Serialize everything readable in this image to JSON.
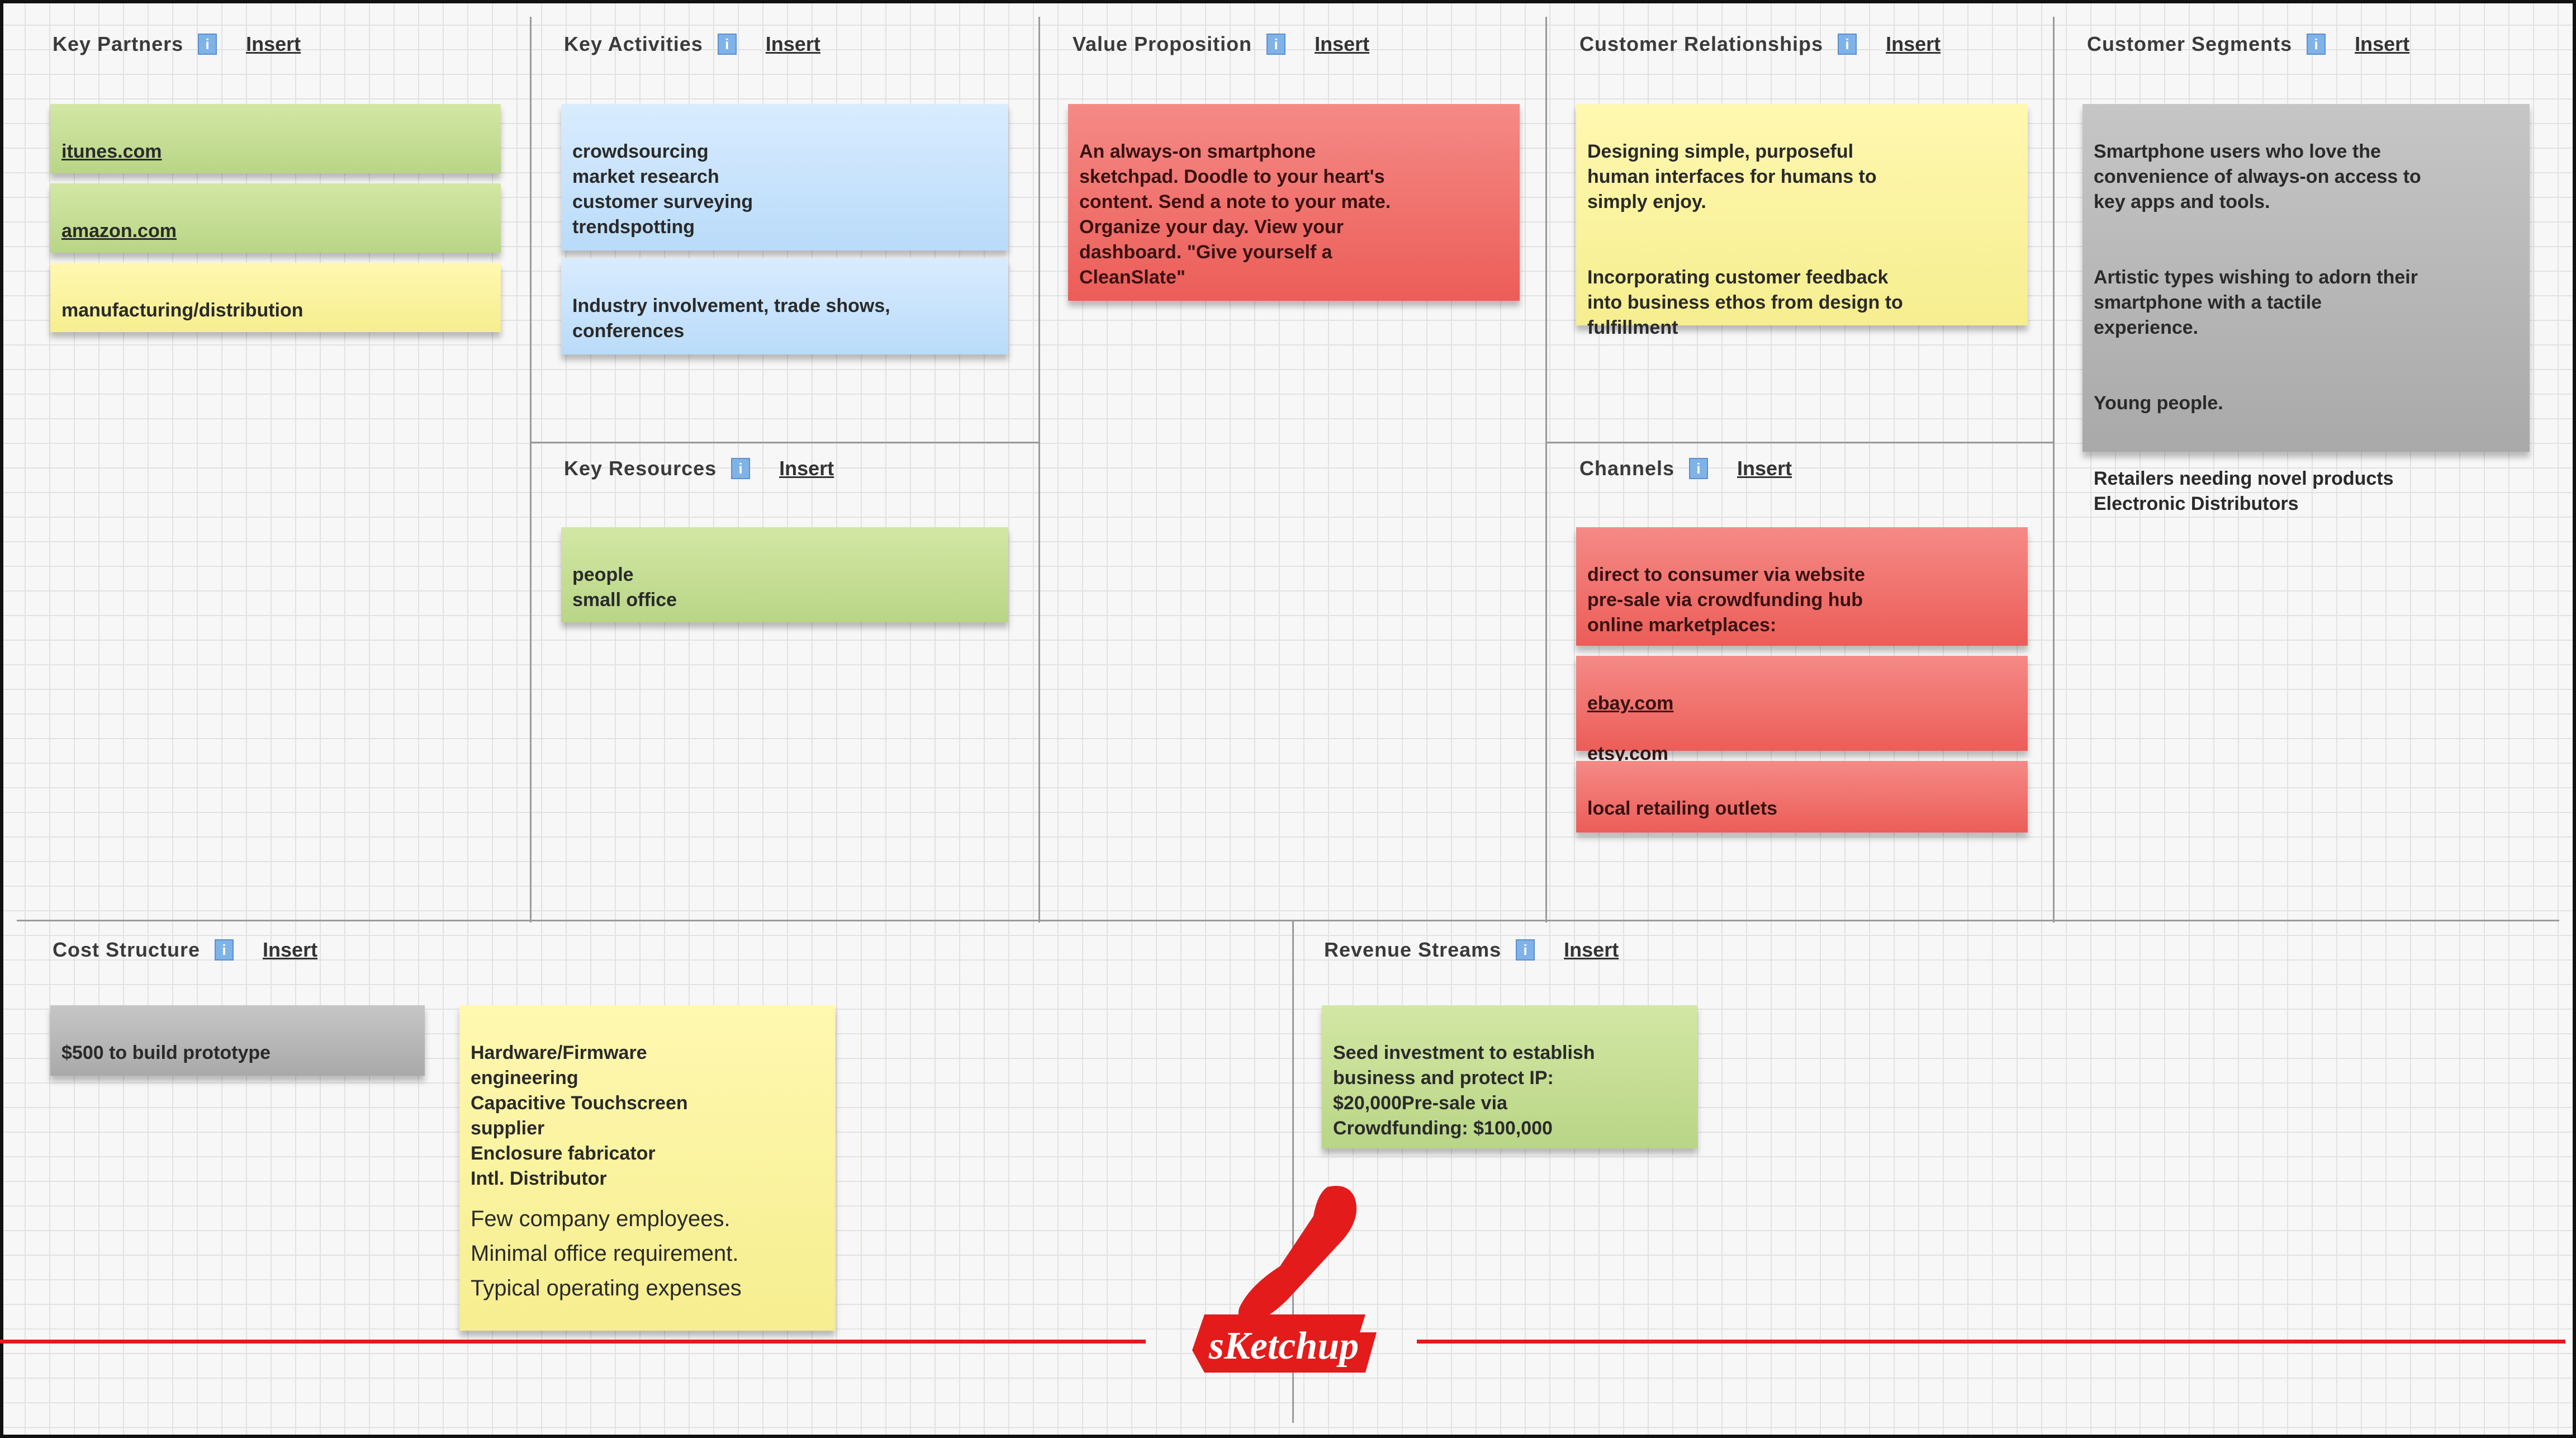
{
  "blocks": {
    "key_partners": {
      "title": "Key Partners",
      "insert": "Insert",
      "notes": [
        "itunes.com",
        "amazon.com",
        "manufacturing/distribution"
      ]
    },
    "key_activities": {
      "title": "Key Activities",
      "insert": "Insert",
      "notes": [
        "crowdsourcing\nmarket research\ncustomer surveying\ntrendspotting",
        "Industry involvement, trade shows,\nconferences"
      ]
    },
    "key_resources": {
      "title": "Key Resources",
      "insert": "Insert",
      "notes": [
        "people\nsmall office"
      ]
    },
    "value_proposition": {
      "title": "Value Proposition",
      "insert": "Insert",
      "notes": [
        "An always-on smartphone\nsketchpad. Doodle to your heart's\ncontent. Send a note to your mate.\nOrganize your day. View your\ndashboard. \"Give yourself a\nCleanSlate\""
      ]
    },
    "customer_relationships": {
      "title": "Customer Relationships",
      "insert": "Insert",
      "notes": {
        "p1": "Designing simple, purposeful\nhuman interfaces for humans to\nsimply enjoy.",
        "p2": "Incorporating customer feedback\ninto business ethos from design to\nfulfillment"
      }
    },
    "channels": {
      "title": "Channels",
      "insert": "Insert",
      "notes": {
        "n1": "direct to consumer via website\npre-sale via crowdfunding hub\nonline marketplaces:",
        "n2a": "ebay.com",
        "n2b": "etsy.com",
        "n3": "local retailing outlets"
      }
    },
    "customer_segments": {
      "title": "Customer Segments",
      "insert": "Insert",
      "notes": {
        "p1": "Smartphone users who love the\nconvenience of always-on access to\nkey apps and tools.",
        "p2": "Artistic types wishing to adorn their\nsmartphone with a tactile\nexperience.",
        "p3": "Young people.",
        "p4": "Retailers needing novel products\nElectronic Distributors"
      }
    },
    "cost_structure": {
      "title": "Cost Structure",
      "insert": "Insert",
      "notes": {
        "n1": "$500 to build prototype",
        "n2": "Hardware/Firmware\nengineering\nCapacitive Touchscreen\nsupplier\nEnclosure fabricator\nIntl. Distributor",
        "n2_extra": "Few company employees.\nMinimal office requirement.\nTypical operating expenses"
      }
    },
    "revenue_streams": {
      "title": "Revenue Streams",
      "insert": "Insert",
      "notes": [
        "Seed investment to establish\nbusiness and protect IP:\n$20,000Pre-sale via\nCrowdfunding: $100,000"
      ]
    }
  },
  "info_icon": "info-icon",
  "logo": {
    "text": "sKetchup",
    "color": "#e41b1b"
  },
  "colors": {
    "green": "#c6df96",
    "yellow": "#fbf39f",
    "blue": "#c9e3fc",
    "red": "#f07470",
    "gray": "#b8b8b8",
    "accent_red": "#e41b1b"
  }
}
